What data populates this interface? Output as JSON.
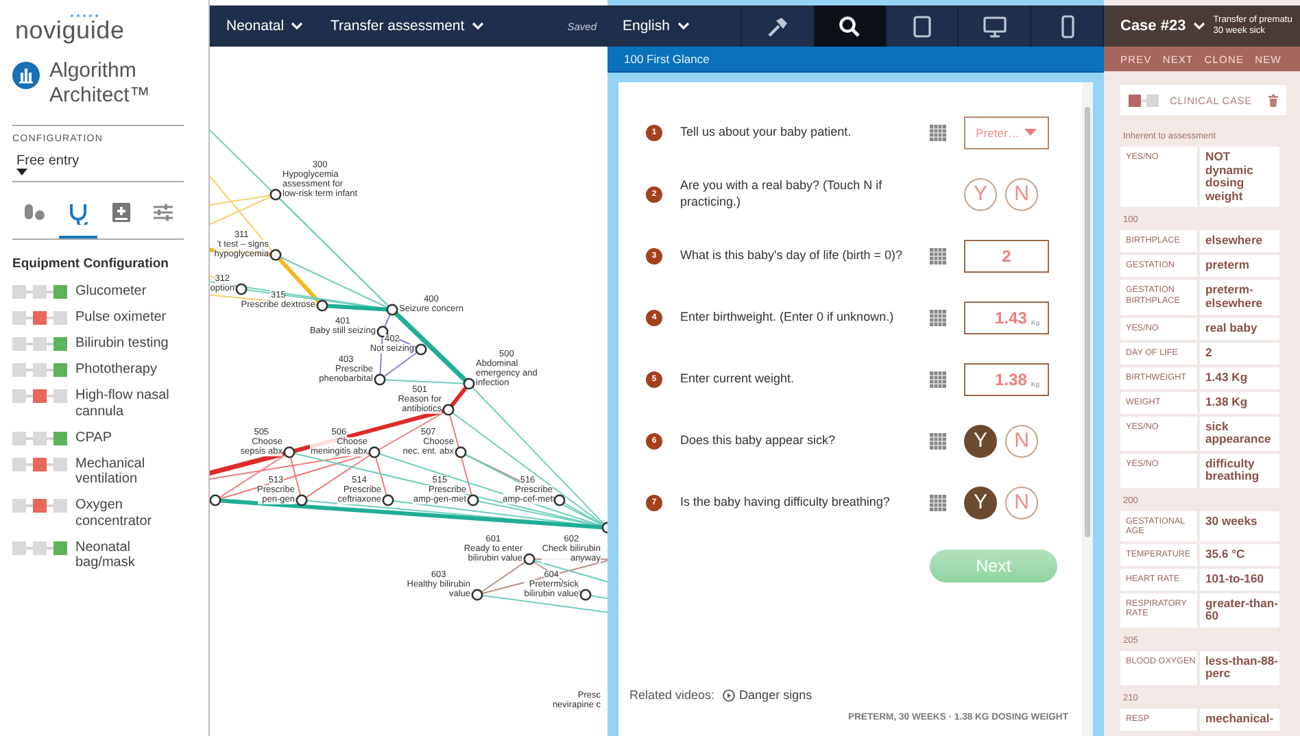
{
  "sidebar": {
    "logo": "noviguide",
    "product": "Algorithm Architect™",
    "configuration": {
      "label": "CONFIGURATION",
      "value": "Free entry"
    },
    "category_tabs": [
      {
        "selected": false
      },
      {
        "selected": true
      },
      {
        "selected": false
      },
      {
        "selected": false
      }
    ],
    "equipment_title": "Equipment Configuration",
    "equipment": [
      {
        "name": "Glucometer",
        "available": true
      },
      {
        "name": "Pulse oximeter",
        "available": false
      },
      {
        "name": "Bilirubin testing",
        "available": true
      },
      {
        "name": "Phototherapy",
        "available": true
      },
      {
        "name": "High-flow nasal cannula",
        "available": false
      },
      {
        "name": "CPAP",
        "available": true
      },
      {
        "name": "Mechanical ventilation",
        "available": false
      },
      {
        "name": "Oxygen concentrator",
        "available": false
      },
      {
        "name": "Neonatal bag/mask",
        "available": true
      }
    ]
  },
  "graph": {
    "menus": [
      "Neonatal",
      "Transfer assessment"
    ],
    "status": "Saved",
    "nodes": [
      {
        "number": "300",
        "label": [
          "Hypoglycemia",
          "assessment for",
          "low-risk term infant"
        ]
      },
      {
        "number": "311",
        "label": [
          "’t test – signs",
          "hypoglycemia"
        ]
      },
      {
        "number": "312",
        "label": [
          "option"
        ]
      },
      {
        "number": "315",
        "label": [
          "Prescribe dextrose"
        ]
      },
      {
        "number": "400",
        "label": [
          "Seizure concern"
        ]
      },
      {
        "number": "401",
        "label": [
          "Baby still seizing"
        ]
      },
      {
        "number": "402",
        "label": [
          "Not seizing"
        ]
      },
      {
        "number": "403",
        "label": [
          "Prescribe",
          "phenobarbital"
        ]
      },
      {
        "number": "500",
        "label": [
          "Abdominal",
          "emergency and",
          "infection"
        ]
      },
      {
        "number": "501",
        "label": [
          "Reason for",
          "antibiotics"
        ]
      },
      {
        "number": "505",
        "label": [
          "Choose",
          "sepsis abx"
        ]
      },
      {
        "number": "506",
        "label": [
          "Choose",
          "meningitis abx"
        ]
      },
      {
        "number": "507",
        "label": [
          "Choose",
          "nec. ent. abx"
        ]
      },
      {
        "number": "513",
        "label": [
          "Prescribe",
          "pen-gen"
        ]
      },
      {
        "number": "514",
        "label": [
          "Prescribe",
          "ceftriaxone"
        ]
      },
      {
        "number": "515",
        "label": [
          "Prescribe",
          "amp-gen-met"
        ]
      },
      {
        "number": "516",
        "label": [
          "Prescribe",
          "amp-cef-met"
        ]
      },
      {
        "number": "601",
        "label": [
          "Ready to enter",
          "bilirubin value"
        ]
      },
      {
        "number": "602",
        "label": [
          "Check bilirubin",
          "anyway"
        ]
      },
      {
        "number": "603",
        "label": [
          "Healthy bilirubin",
          "value"
        ]
      },
      {
        "number": "604",
        "label": [
          "Preterm/sick",
          "bilirubin value"
        ]
      },
      {
        "label": [
          "Presc",
          "nevirapine c"
        ]
      }
    ]
  },
  "form": {
    "language": "English",
    "view_tabs": [
      {
        "selected": false
      },
      {
        "selected": true
      },
      {
        "selected": false
      },
      {
        "selected": false
      },
      {
        "selected": false
      }
    ],
    "section": "100 First Glance",
    "questions": [
      {
        "number": "1",
        "text": "Tell us about your baby patient.",
        "calculator": true,
        "answer": {
          "kind": "dropdown",
          "value": "Preter…"
        }
      },
      {
        "number": "2",
        "text": "Are you with a real baby? (Touch N if practicing.)",
        "calculator": false,
        "answer": {
          "kind": "yes_no",
          "options": [
            {
              "label": "Y",
              "selected": false
            },
            {
              "label": "N",
              "selected": false
            }
          ]
        }
      },
      {
        "number": "3",
        "text": "What is this baby's day of life (birth = 0)?",
        "calculator": true,
        "answer": {
          "kind": "number",
          "value": "2"
        }
      },
      {
        "number": "4",
        "text": "Enter birthweight. (Enter 0 if unknown.)",
        "calculator": true,
        "answer": {
          "kind": "number",
          "value": "1.43",
          "unit": "Kg"
        }
      },
      {
        "number": "5",
        "text": "Enter current weight.",
        "calculator": true,
        "answer": {
          "kind": "number",
          "value": "1.38",
          "unit": "Kg"
        }
      },
      {
        "number": "6",
        "text": "Does this baby appear sick?",
        "calculator": true,
        "answer": {
          "kind": "yes_no",
          "options": [
            {
              "label": "Y",
              "selected": true
            },
            {
              "label": "N",
              "selected": false
            }
          ]
        }
      },
      {
        "number": "7",
        "text": "Is the baby having difficulty breathing?",
        "calculator": true,
        "answer": {
          "kind": "yes_no",
          "options": [
            {
              "label": "Y",
              "selected": true
            },
            {
              "label": "N",
              "selected": false
            }
          ]
        }
      }
    ],
    "next": "Next",
    "related_label": "Related videos:",
    "related_link": "Danger signs",
    "footer": "PRETERM, 30 WEEKS · 1.38 KG DOSING WEIGHT"
  },
  "case": {
    "title": "Case #23",
    "subtitle": [
      "Transfer of prematu",
      "30 week sick"
    ],
    "nav": [
      "PREV",
      "NEXT",
      "CLONE",
      "NEW"
    ],
    "card": {
      "label": "CLINICAL CASE",
      "active": true
    },
    "sections": [
      {
        "heading": "Inherent to assessment",
        "rows": [
          {
            "key": "YES/NO",
            "value": "NOT dynamic dosing weight"
          }
        ]
      },
      {
        "heading": "100",
        "rows": [
          {
            "key": "BIRTHPLACE",
            "value": "elsewhere"
          },
          {
            "key": "GESTATION",
            "value": "preterm"
          },
          {
            "key": "GESTATION BIRTHPLACE",
            "value": "preterm-elsewhere"
          },
          {
            "key": "YES/NO",
            "value": "real baby"
          },
          {
            "key": "DAY OF LIFE",
            "value": "2"
          },
          {
            "key": "BIRTHWEIGHT",
            "value": "1.43 Kg"
          },
          {
            "key": "WEIGHT",
            "value": "1.38 Kg"
          },
          {
            "key": "YES/NO",
            "value": "sick appearance"
          },
          {
            "key": "YES/NO",
            "value": "difficulty breathing"
          }
        ]
      },
      {
        "heading": "200",
        "rows": [
          {
            "key": "GESTATIONAL AGE",
            "value": "30 weeks"
          },
          {
            "key": "TEMPERATURE",
            "value": "35.6 °C"
          },
          {
            "key": "HEART RATE",
            "value": "101-to-160"
          },
          {
            "key": "RESPIRATORY RATE",
            "value": "greater-than-60"
          }
        ]
      },
      {
        "heading": "205",
        "rows": [
          {
            "key": "BLOOD OXYGEN",
            "value": "less-than-88-perc"
          }
        ]
      },
      {
        "heading": "210",
        "rows": [
          {
            "key": "RESP",
            "value": "mechanical-"
          }
        ]
      }
    ]
  }
}
